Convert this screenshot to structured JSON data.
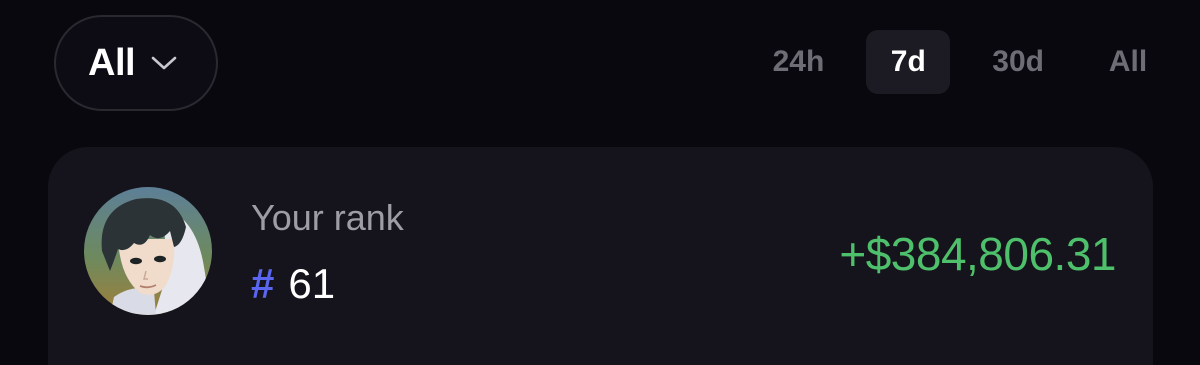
{
  "filter": {
    "label": "All",
    "icon": "chevron-down-icon"
  },
  "time_tabs": [
    {
      "label": "24h",
      "active": false
    },
    {
      "label": "7d",
      "active": true
    },
    {
      "label": "30d",
      "active": false
    },
    {
      "label": "All",
      "active": false
    }
  ],
  "rank_card": {
    "avatar": "user-avatar",
    "label": "Your rank",
    "hash": "#",
    "rank": "61",
    "pnl": "+$384,806.31"
  },
  "colors": {
    "background": "#09080f",
    "card": "#15141c",
    "accent_hash": "#5b66f0",
    "positive": "#4ec06b",
    "muted_text": "#9e9da5",
    "inactive_tab": "#6e6d75"
  }
}
